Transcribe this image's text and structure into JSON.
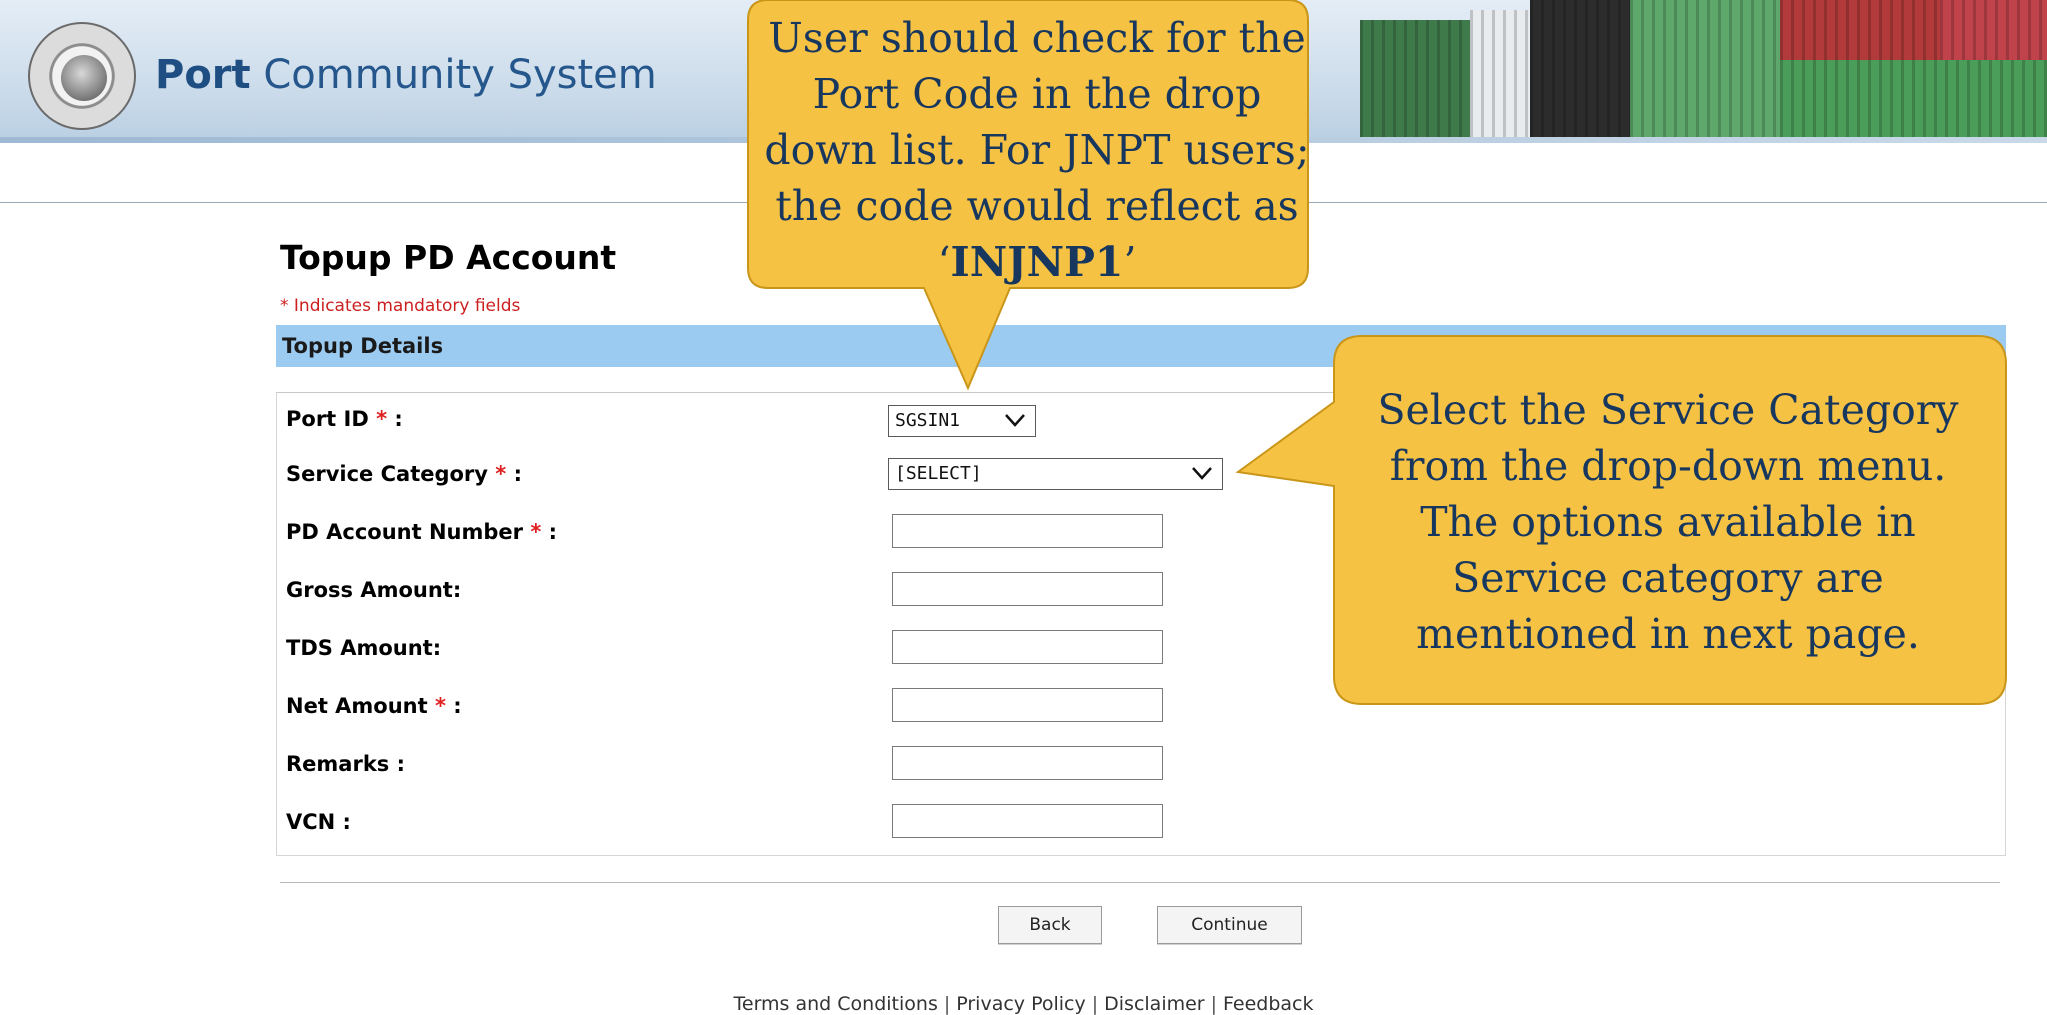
{
  "header": {
    "brand_bold": "Port",
    "brand_light": "Community System"
  },
  "page": {
    "title": "Topup PD Account",
    "mandatory_note": "* Indicates mandatory fields",
    "section_title": "Topup Details"
  },
  "form": {
    "port_id": {
      "label": "Port ID ",
      "req": "*",
      "suffix": " :",
      "value": "SGSIN1"
    },
    "service_category": {
      "label": "Service Category ",
      "req": "*",
      "suffix": " :",
      "value": "[SELECT]"
    },
    "pd_account_number": {
      "label": "PD Account Number ",
      "req": "*",
      "suffix": " :",
      "value": ""
    },
    "gross_amount": {
      "label": "Gross Amount:",
      "value": ""
    },
    "tds_amount": {
      "label": "TDS Amount:",
      "value": ""
    },
    "net_amount": {
      "label": "Net Amount ",
      "req": "*",
      "suffix": " :",
      "value": ""
    },
    "remarks": {
      "label": "Remarks :",
      "value": ""
    },
    "vcn": {
      "label": "VCN :",
      "value": ""
    }
  },
  "buttons": {
    "back": "Back",
    "continue": "Continue"
  },
  "footer": {
    "terms": "Terms and Conditions",
    "privacy": "Privacy Policy",
    "disclaimer": "Disclaimer",
    "feedback": "Feedback",
    "separator": "|"
  },
  "callouts": {
    "port_code": {
      "text_before": "User should check for the Port Code in the drop down list. For JNPT users; the code would reflect as ‘",
      "code": "INJNP1",
      "text_after": "’"
    },
    "service_category": {
      "text": "Select the Service Category from the drop-down menu. The options available in Service category are mentioned in next page."
    }
  },
  "colors": {
    "section_header_bg": "#9ccbf2",
    "required_marker": "#e02020",
    "callout_fill": "#f6c244",
    "callout_text": "#17375e",
    "brand_blue": "#1f4f82"
  }
}
